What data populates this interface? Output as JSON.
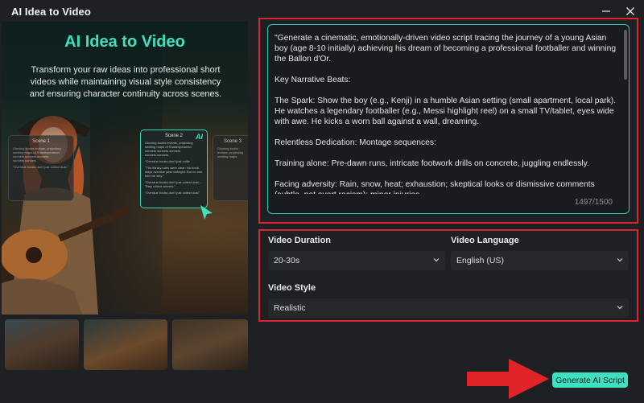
{
  "window": {
    "title": "AI Idea to Video"
  },
  "hero": {
    "heading": "AI Idea to Video",
    "subtitle": "Transform your raw ideas into professional short videos while maintaining visual style consistency and ensuring character continuity across scenes.",
    "cards": {
      "left": {
        "title": "Scene 1",
        "lines": [
          "Glowing books levitate, projecting swirling maps of Shakespearean sonnets.sonnets.sonnets sonnets.sonnets.",
          "\"Overdue books don't just collect dust.\""
        ]
      },
      "center": {
        "title": "Scene 2",
        "badge": "AI",
        "lines": [
          "Glowing books levitate, projecting swirling maps of Shakespearean sonnets.sonnets.sonnets sonnets.sonnets.",
          "\"Overdue books don't just collie",
          "\"The library rules were clear: No book stays overdue past midnight. But no one told me why.\"",
          "\"Overdue books don't just collect dust... They collect secrets.\"",
          "\"Overdue books don't just collect dust\""
        ]
      },
      "right": {
        "title": "Scene 3",
        "lines": [
          "Glowing books levitate, projecting swirling maps"
        ]
      }
    }
  },
  "script": {
    "paragraphs": [
      "\"Generate a cinematic, emotionally-driven video script tracing the journey of a young Asian boy (age 8-10 initially) achieving his dream of becoming a professional footballer and winning the Ballon d'Or.",
      "Key Narrative Beats:",
      "The Spark: Show the boy (e.g., Kenji) in a humble Asian setting (small apartment, local park). He watches a legendary footballer (e.g., Messi highlight reel) on a small TV/tablet, eyes wide with awe. He kicks a worn ball against a wall, dreaming.",
      "Relentless Dedication: Montage sequences:",
      "Training alone: Pre-dawn runs, intricate footwork drills on concrete, juggling endlessly.",
      "Facing adversity: Rain, snow, heat; exhaustion; skeptical looks or dismissive comments (subtle, not overt racism); minor injuries."
    ],
    "char_count": "1497/1500",
    "scroll_fraction_visible": 0.3
  },
  "settings": {
    "duration": {
      "label": "Video Duration",
      "value": "20-30s"
    },
    "language": {
      "label": "Video Language",
      "value": "English (US)"
    },
    "style": {
      "label": "Video Style",
      "value": "Realistic"
    }
  },
  "actions": {
    "generate_label": "Generate AI Script"
  },
  "colors": {
    "accent": "#3fe0c0",
    "highlight_outline": "#d9262e",
    "arrow": "#e0242a",
    "background": "#1f2024"
  },
  "icons": {
    "minimize": "minimize-icon",
    "close": "close-icon",
    "dropdown": "chevron-down-icon"
  }
}
